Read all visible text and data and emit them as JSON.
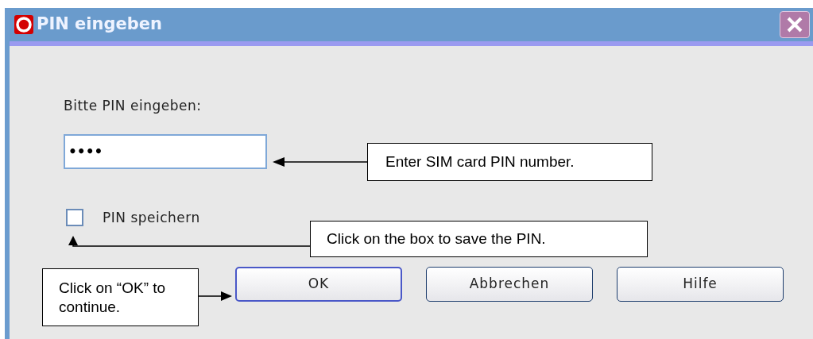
{
  "window": {
    "title": "PIN eingeben"
  },
  "prompt": "Bitte PIN eingeben:",
  "pin_field": {
    "value": "••••"
  },
  "save_pin": {
    "label": "PIN speichern",
    "checked": false
  },
  "buttons": [
    {
      "label": "OK",
      "default": true
    },
    {
      "label": "Abbrechen",
      "default": false
    },
    {
      "label": "Hilfe",
      "default": false
    }
  ],
  "callouts": [
    {
      "text": "Enter SIM card PIN number."
    },
    {
      "text": "Click on the box to save the PIN."
    },
    {
      "text": "Click on “OK” to continue."
    }
  ]
}
